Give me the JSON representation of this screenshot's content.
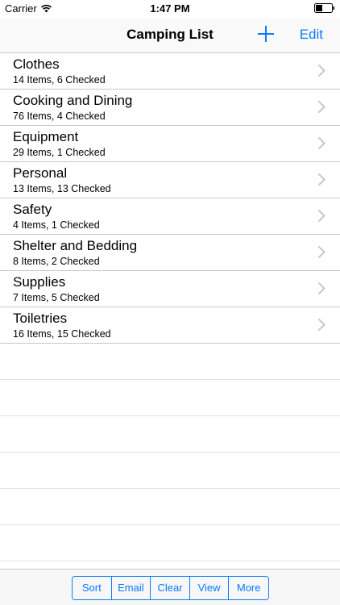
{
  "status": {
    "carrier": "Carrier",
    "time": "1:47 PM"
  },
  "nav": {
    "title": "Camping List",
    "edit_label": "Edit"
  },
  "categories": [
    {
      "title": "Clothes",
      "subtitle": "14 Items, 6 Checked"
    },
    {
      "title": "Cooking and Dining",
      "subtitle": "76 Items, 4 Checked"
    },
    {
      "title": "Equipment",
      "subtitle": "29 Items, 1 Checked"
    },
    {
      "title": "Personal",
      "subtitle": "13 Items, 13 Checked"
    },
    {
      "title": "Safety",
      "subtitle": "4 Items, 1 Checked"
    },
    {
      "title": "Shelter and Bedding",
      "subtitle": "8 Items, 2 Checked"
    },
    {
      "title": "Supplies",
      "subtitle": "7 Items, 5 Checked"
    },
    {
      "title": "Toiletries",
      "subtitle": "16 Items, 15 Checked"
    }
  ],
  "toolbar": {
    "buttons": [
      "Sort",
      "Email",
      "Clear",
      "View",
      "More"
    ]
  },
  "colors": {
    "accent": "#0a7aff",
    "chevron": "#c7c7cc",
    "separator": "#c8c7cc"
  }
}
